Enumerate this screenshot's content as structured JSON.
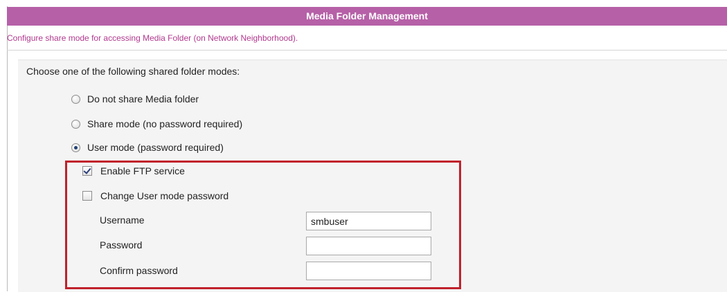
{
  "header": {
    "title": "Media Folder Management"
  },
  "description": "Configure share mode for accessing Media Folder (on Network Neighborhood).",
  "share_modes": {
    "prompt": "Choose one of the following shared folder modes:",
    "options": [
      {
        "label": "Do not share Media folder",
        "checked": false
      },
      {
        "label": "Share mode (no password required)",
        "checked": false
      },
      {
        "label": "User mode (password required)",
        "checked": true
      }
    ]
  },
  "user_mode": {
    "enable_ftp": {
      "label": "Enable FTP service",
      "checked": true
    },
    "change_password": {
      "label": "Change User mode password",
      "checked": false
    },
    "fields": {
      "username": {
        "label": "Username",
        "value": "smbuser"
      },
      "password": {
        "label": "Password",
        "value": ""
      },
      "confirm_password": {
        "label": "Confirm password",
        "value": ""
      }
    }
  },
  "colors": {
    "title_bar": "#b660a7",
    "description_text": "#b1398e",
    "highlight_box": "#c0212b"
  }
}
